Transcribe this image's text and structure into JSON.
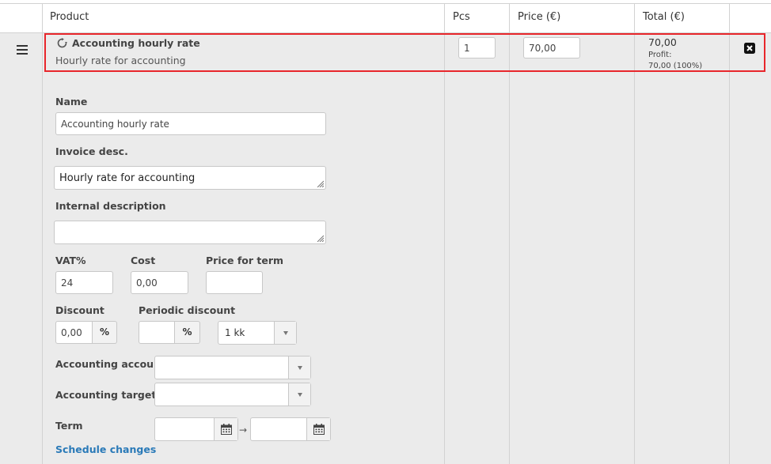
{
  "header": {
    "col_product": "Product",
    "col_pcs": "Pcs",
    "col_price": "Price (€)",
    "col_total": "Total (€)"
  },
  "row": {
    "product_name": "Accounting hourly rate",
    "product_desc": "Hourly rate for accounting",
    "pcs": "1",
    "price": "70,00",
    "total": "70,00",
    "profit_label": "Profit:",
    "profit_value": "70,00 (100%)"
  },
  "form": {
    "name_label": "Name",
    "name_value": "Accounting hourly rate",
    "invoice_desc_label": "Invoice desc.",
    "invoice_desc_value": "Hourly rate for accounting",
    "internal_desc_label": "Internal description",
    "internal_desc_value": "",
    "vat_label": "VAT%",
    "vat_value": "24",
    "cost_label": "Cost",
    "cost_value": "0,00",
    "price_term_label": "Price for term",
    "price_term_value": "",
    "discount_label": "Discount",
    "discount_value": "0,00",
    "discount_unit": "%",
    "periodic_discount_label": "Periodic discount",
    "periodic_discount_value": "",
    "periodic_discount_unit": "%",
    "period_select": "1 kk",
    "accounting_account_label": "Accounting account",
    "accounting_account_value": "",
    "accounting_target_label": "Accounting target",
    "accounting_target_value": "",
    "term_label": "Term",
    "term_start": "",
    "term_end": "",
    "term_arrow": "→",
    "schedule_link": "Schedule changes"
  },
  "colors": {
    "highlight": "#e8262b",
    "link": "#2a7ab8",
    "row_bg": "#ebebeb"
  },
  "icons": {
    "drag": "hamburger-icon",
    "recurring": "recurring-icon",
    "remove": "remove-icon",
    "calendar": "calendar-icon"
  }
}
